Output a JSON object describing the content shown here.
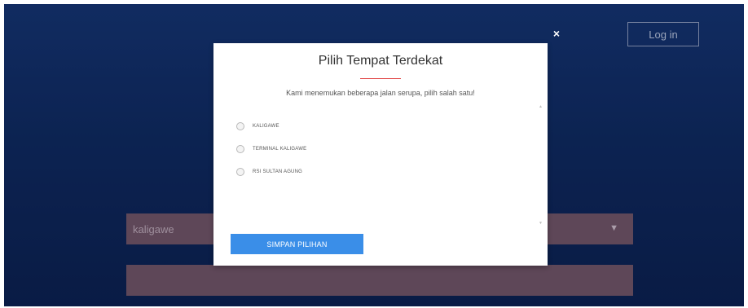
{
  "header": {
    "login_label": "Log in"
  },
  "search": {
    "select_value": "kaligawe",
    "caret_icon": "chevron-down-icon"
  },
  "modal": {
    "close_icon": "close-icon",
    "close_glyph": "×",
    "title": "Pilih Tempat Terdekat",
    "subtitle": "Kami menemukan beberapa jalan serupa, pilih salah satu!",
    "options": [
      {
        "label": "KALIGAWE"
      },
      {
        "label": "TERMINAL KALIGAWE"
      },
      {
        "label": "RSI SULTAN AGUNG"
      }
    ],
    "save_label": "SIMPAN PILIHAN"
  },
  "colors": {
    "background": "#0e2658",
    "accent_button": "#3a8ee8",
    "title_rule": "#e04040",
    "input_bg": "#6e5060"
  }
}
